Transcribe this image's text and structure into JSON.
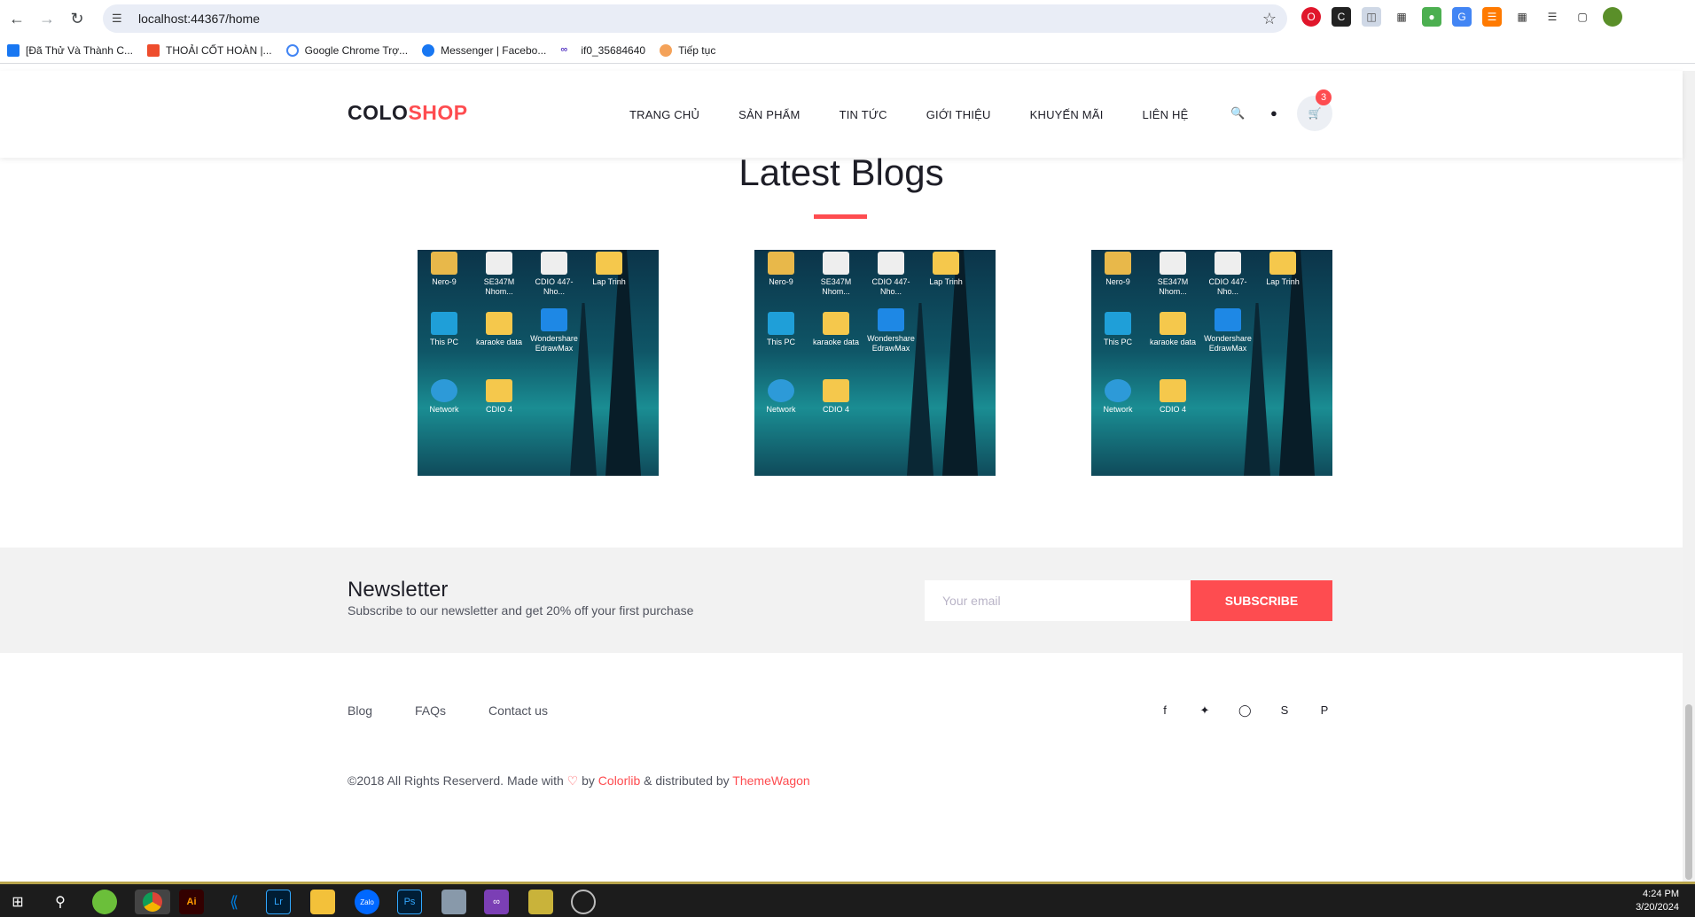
{
  "browser": {
    "url": "localhost:44367/home",
    "bookmarks": [
      "[Đã Thử Và Thành C...",
      "THOẢI CỐT HOÀN |...",
      "Google Chrome Trợ...",
      "Messenger | Facebo...",
      "if0_35684640",
      "Tiếp tục"
    ]
  },
  "header": {
    "logo_part1": "COLO",
    "logo_part2": "SHOP",
    "nav": [
      "TRANG CHỦ",
      "SẢN PHẨM",
      "TIN TỨC",
      "GIỚI THIỆU",
      "KHUYẾN MÃI",
      "LIÊN HỆ"
    ],
    "cart_count": "3"
  },
  "blogs": {
    "title": "Latest Blogs",
    "desktop_icons": [
      "Nero-9",
      "SE347M Nhom...",
      "CDIO 447-Nho...",
      "Lap Trinh",
      "This PC",
      "karaoke data",
      "Wondershare EdrawMax",
      "Network",
      "CDIO 4"
    ]
  },
  "newsletter": {
    "title": "Newsletter",
    "subtitle": "Subscribe to our newsletter and get 20% off your first purchase",
    "placeholder": "Your email",
    "button": "SUBSCRIBE"
  },
  "footer": {
    "links": [
      "Blog",
      "FAQs",
      "Contact us"
    ],
    "copyright_prefix": "©2018 All Rights Reserverd. Made with",
    "by": "by",
    "colorlib": "Colorlib",
    "distributed": "& distributed by",
    "themewagon": "ThemeWagon"
  },
  "taskbar": {
    "time": "4:24 PM",
    "date": "3/20/2024"
  },
  "colors": {
    "accent": "#fe4c50",
    "dark": "#1e1e27"
  }
}
